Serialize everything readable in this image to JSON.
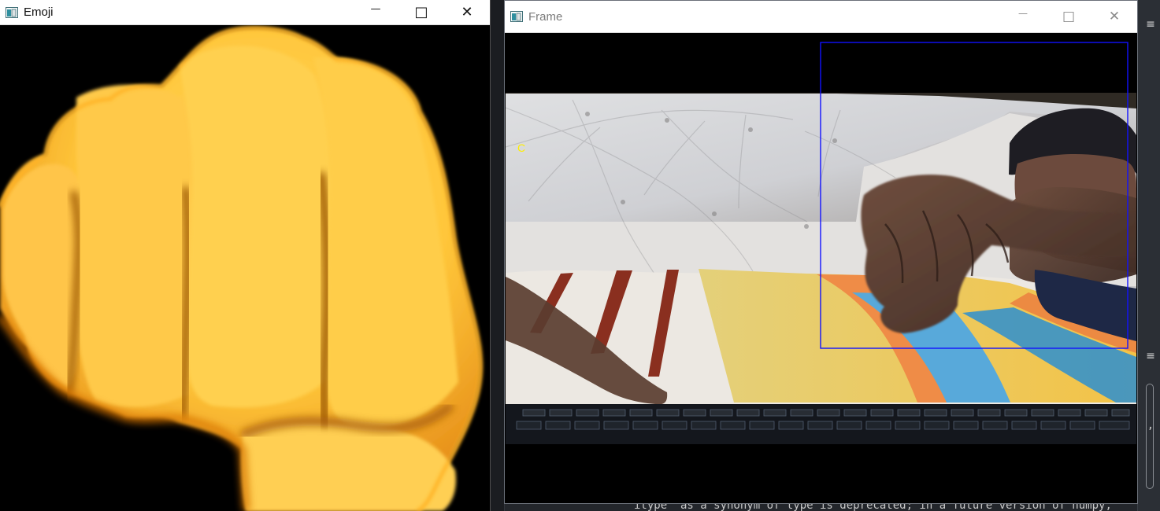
{
  "windows": {
    "emoji": {
      "title": "Emoji",
      "icon": "opencv-window-icon",
      "controls": {
        "minimize": "—",
        "maximize": "□",
        "close": "✕"
      }
    },
    "frame": {
      "title": "Frame",
      "icon": "opencv-window-icon",
      "controls": {
        "minimize": "—",
        "maximize": "□",
        "close": "✕"
      },
      "overlay_text": "C"
    }
  },
  "ide": {
    "console_line": "itype' as a synonym of type is deprecated; in a future version of numpy,",
    "trailing_comma": ",",
    "hamburger": "≡"
  },
  "colors": {
    "emoji_yellow": "#ffcc4d",
    "emoji_orange": "#f4a622",
    "roi_box": "#1212ff",
    "overlay_text": "#ffee00"
  }
}
